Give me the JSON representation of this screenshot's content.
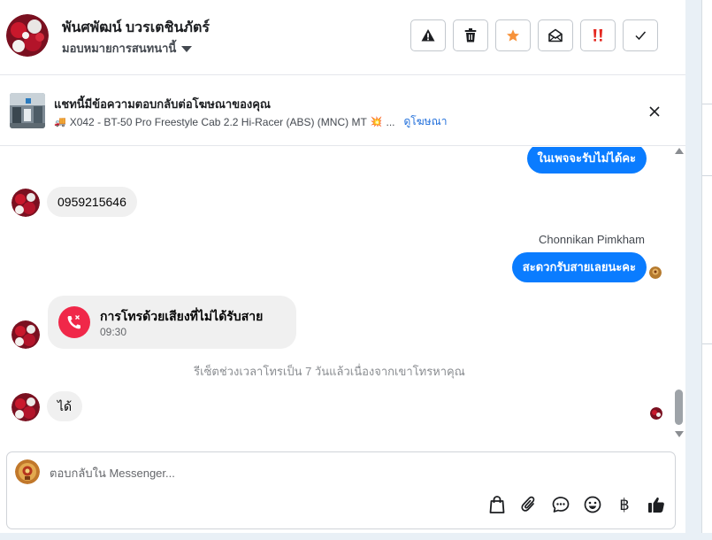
{
  "header": {
    "contact_name": "พันศพัฒน์ บวรเตชินภัตร์",
    "assign_label": "มอบหมายการสนทนานี้",
    "actions": [
      {
        "name": "report-spam-button",
        "icon": "warning-icon"
      },
      {
        "name": "delete-button",
        "icon": "trash-icon"
      },
      {
        "name": "star-button",
        "icon": "star-icon"
      },
      {
        "name": "mark-unread-button",
        "icon": "envelope-open-icon"
      },
      {
        "name": "follow-up-button",
        "icon": "double-exclamation-icon"
      },
      {
        "name": "mark-done-button",
        "icon": "checkmark-icon"
      }
    ],
    "star_color": "#f7923a",
    "follow_up_color": "#e4271f"
  },
  "ad_banner": {
    "title": "แชทนี้มีข้อความตอบกลับต่อโฆษณาของคุณ",
    "truck_emoji": "🚚",
    "ad_text": "X042 - BT-50 Pro Freestyle Cab 2.2 Hi-Racer (ABS) (MNC) MT",
    "spark_emoji": "💥",
    "ellipsis": "...",
    "link_label": "ดูโฆษณา"
  },
  "messages": {
    "out_1": "ในเพจจะรับไม่ได้คะ",
    "in_1": "0959215646",
    "sender_name": "Chonnikan Pimkham",
    "out_2": "สะดวกรับสายเลยนะคะ",
    "missed_call_title": "การโทรด้วยเสียงที่ไม่ได้รับสาย",
    "missed_call_time": "09:30",
    "system_note": "รีเซ็ตช่วงเวลาโทรเป็น 7 วันแล้วเนื่องจากเขาโทรหาคุณ",
    "in_2": "ได้"
  },
  "composer": {
    "placeholder": "ตอบกลับใน Messenger...",
    "value": "",
    "tools": [
      "shopping-bag-icon",
      "paperclip-icon",
      "saved-reply-icon",
      "emoji-icon",
      "baht-icon",
      "thumbs-up-icon"
    ],
    "baht_symbol": "฿"
  },
  "colors": {
    "outgoing_bubble": "#0a7cff",
    "incoming_bubble": "#f0f0f0",
    "missed_call": "#f02849",
    "link": "#216fdb"
  }
}
